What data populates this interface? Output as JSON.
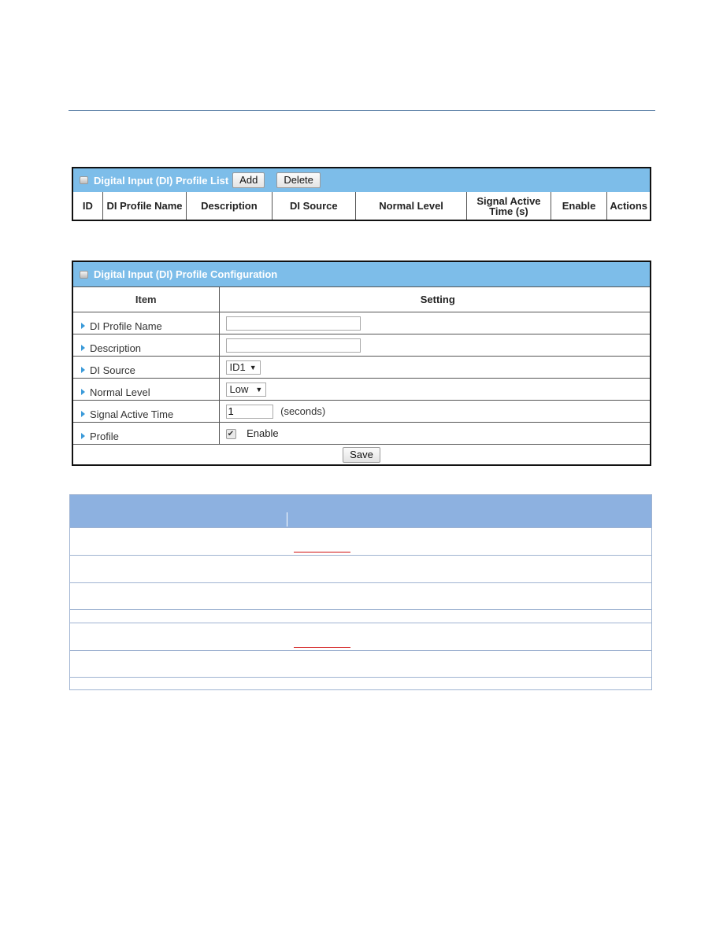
{
  "list_panel": {
    "title": "Digital Input (DI) Profile List",
    "add_label": "Add",
    "delete_label": "Delete",
    "columns": [
      "ID",
      "DI Profile Name",
      "Description",
      "DI Source",
      "Normal Level",
      "Signal Active Time (s)",
      "Enable",
      "Actions"
    ]
  },
  "config_panel": {
    "title": "Digital Input (DI) Profile Configuration",
    "header": {
      "item": "Item",
      "setting": "Setting"
    },
    "rows": [
      {
        "label": "DI Profile Name",
        "value": ""
      },
      {
        "label": "Description",
        "value": ""
      },
      {
        "label": "DI Source",
        "value": "ID1"
      },
      {
        "label": "Normal Level",
        "value": "Low"
      },
      {
        "label": "Signal Active Time",
        "value": "1",
        "suffix": "(seconds)"
      },
      {
        "label": "Profile",
        "checked": true,
        "checkbox_label": "Enable"
      }
    ],
    "save_label": "Save"
  },
  "icons": {
    "title_icon": "panel-bullet-icon",
    "row_arrow": "triangle-right-icon",
    "select_caret": "▼",
    "check_mark": "✔"
  },
  "colors": {
    "title_bar": "#7dbde9",
    "desc_header": "#8db1e0",
    "arrow": "#3a9ad9",
    "underline": "#d01010"
  }
}
